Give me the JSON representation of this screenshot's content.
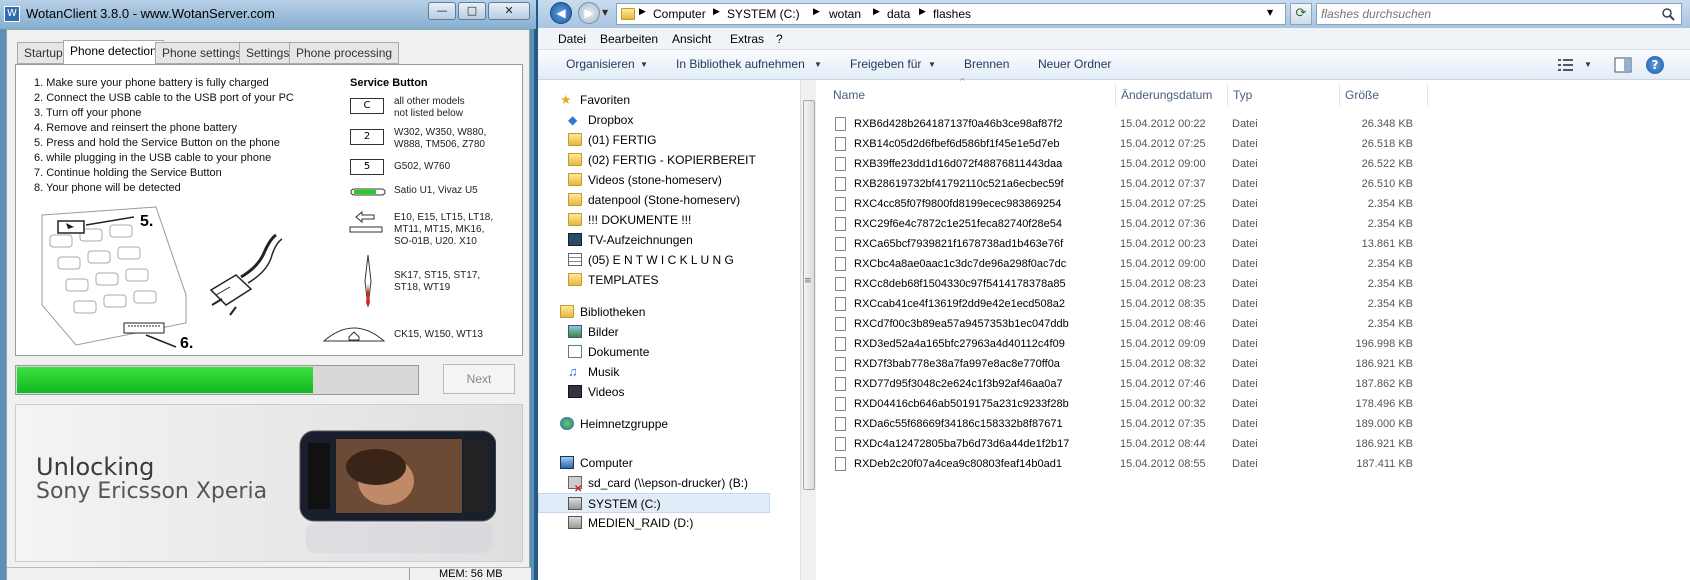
{
  "wotan": {
    "title": "WotanClient 3.8.0 - www.WotanServer.com",
    "tabs": [
      "Startup",
      "Phone detection",
      "Phone settings",
      "Settings",
      "Phone processing"
    ],
    "steps": [
      "1. Make sure your phone battery is fully charged",
      "2. Connect the USB cable to the USB port of your PC",
      "3. Turn off your phone",
      "4. Remove and reinsert the phone battery",
      "5. Press and hold the Service Button on the phone",
      "6. while plugging in the USB cable to your phone",
      "7. Continue holding the Service Button",
      "8. Your phone will be detected"
    ],
    "service_button_title": "Service Button",
    "service_buttons": [
      {
        "key": "C",
        "models": "all other models\nnot listed below"
      },
      {
        "key": "2",
        "models": "W302, W350, W880,\nW888, TM506, Z780"
      },
      {
        "key": "5",
        "models": "G502, W760"
      },
      {
        "key": "",
        "models": "Satio U1, Vivaz U5"
      },
      {
        "key": "",
        "models": "E10, E15, LT15, LT18,\nMT11, MT15, MK16,\nSO-01B, U20. X10"
      },
      {
        "key": "",
        "models": "SK17, ST15, ST17,\nST18, WT19"
      },
      {
        "key": "",
        "models": "CK15, W150, WT13"
      }
    ],
    "diagram_labels": [
      "5.",
      "6."
    ],
    "progress": 0.74,
    "next_label": "Next",
    "banner": {
      "line1": "Unlocking",
      "line2": "Sony Ericsson Xperia"
    },
    "status": "MEM: 56 MB"
  },
  "explorer": {
    "path": [
      "Computer",
      "SYSTEM (C:)",
      "wotan",
      "data",
      "flashes"
    ],
    "search_placeholder": "flashes durchsuchen",
    "menu": [
      "Datei",
      "Bearbeiten",
      "Ansicht",
      "Extras",
      "?"
    ],
    "toolbar": [
      "Organisieren",
      "In Bibliothek aufnehmen",
      "Freigeben für",
      "Brennen",
      "Neuer Ordner"
    ],
    "nav": {
      "favorites_label": "Favoriten",
      "favorites": [
        "Dropbox",
        "(01) FERTIG",
        "(02) FERTIG - KOPIERBEREIT",
        "Videos (stone-homeserv)",
        "datenpool (Stone-homeserv)",
        "!!! DOKUMENTE !!!",
        "TV-Aufzeichnungen",
        "(05) E N T W I C K L U N G",
        "TEMPLATES"
      ],
      "libraries_label": "Bibliotheken",
      "libraries": [
        "Bilder",
        "Dokumente",
        "Musik",
        "Videos"
      ],
      "homegroup_label": "Heimnetzgruppe",
      "computer_label": "Computer",
      "drives": [
        "sd_card (\\\\epson-drucker) (B:)",
        "SYSTEM (C:)",
        "MEDIEN_RAID (D:)"
      ]
    },
    "columns": [
      "Name",
      "Änderungsdatum",
      "Typ",
      "Größe"
    ],
    "files": [
      [
        "RXB6d428b264187137f0a46b3ce98af87f2",
        "15.04.2012 00:22",
        "Datei",
        "26.348 KB"
      ],
      [
        "RXB14c05d2d6fbef6d586bf1f45e1e5d7eb",
        "15.04.2012 07:25",
        "Datei",
        "26.518 KB"
      ],
      [
        "RXB39ffe23dd1d16d072f48876811443daa",
        "15.04.2012 09:00",
        "Datei",
        "26.522 KB"
      ],
      [
        "RXB28619732bf41792110c521a6ecbec59f",
        "15.04.2012 07:37",
        "Datei",
        "26.510 KB"
      ],
      [
        "RXC4cc85f07f9800fd8199ecec983869254",
        "15.04.2012 07:25",
        "Datei",
        "2.354 KB"
      ],
      [
        "RXC29f6e4c7872c1e251feca82740f28e54",
        "15.04.2012 07:36",
        "Datei",
        "2.354 KB"
      ],
      [
        "RXCa65bcf7939821f1678738ad1b463e76f",
        "15.04.2012 00:23",
        "Datei",
        "13.861 KB"
      ],
      [
        "RXCbc4a8ae0aac1c3dc7de96a298f0ac7dc",
        "15.04.2012 09:00",
        "Datei",
        "2.354 KB"
      ],
      [
        "RXCc8deb68f1504330c97f5414178378a85",
        "15.04.2012 08:23",
        "Datei",
        "2.354 KB"
      ],
      [
        "RXCcab41ce4f13619f2dd9e42e1ecd508a2",
        "15.04.2012 08:35",
        "Datei",
        "2.354 KB"
      ],
      [
        "RXCd7f00c3b89ea57a9457353b1ec047ddb",
        "15.04.2012 08:46",
        "Datei",
        "2.354 KB"
      ],
      [
        "RXD3ed52a4a165bfc27963a4d40112c4f09",
        "15.04.2012 09:09",
        "Datei",
        "196.998 KB"
      ],
      [
        "RXD7f3bab778e38a7fa997e8ac8e770ff0a",
        "15.04.2012 08:32",
        "Datei",
        "186.921 KB"
      ],
      [
        "RXD77d95f3048c2e624c1f3b92af46aa0a7",
        "15.04.2012 07:46",
        "Datei",
        "187.862 KB"
      ],
      [
        "RXD04416cb646ab5019175a231c9233f28b",
        "15.04.2012 00:32",
        "Datei",
        "178.496 KB"
      ],
      [
        "RXDa6c55f68669f34186c158332b8f87671",
        "15.04.2012 07:35",
        "Datei",
        "189.000 KB"
      ],
      [
        "RXDc4a12472805ba7b6d73d6a44de1f2b17",
        "15.04.2012 08:44",
        "Datei",
        "186.921 KB"
      ],
      [
        "RXDeb2c20f07a4cea9c80803feaf14b0ad1",
        "15.04.2012 08:55",
        "Datei",
        "187.411 KB"
      ]
    ]
  }
}
